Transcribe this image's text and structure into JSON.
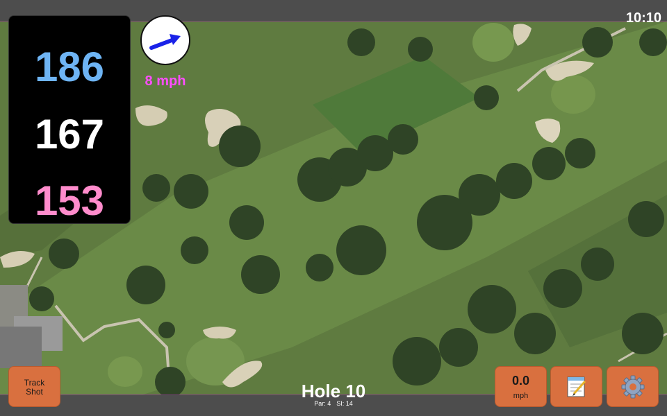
{
  "status_bar": {
    "time": "10:10"
  },
  "distances": {
    "back": "186",
    "middle": "167",
    "front": "153"
  },
  "wind": {
    "speed": "8 mph",
    "direction_icon": "arrow-right-up-icon"
  },
  "hole": {
    "title": "Hole 10",
    "par": "Par: 4",
    "stroke_index": "SI: 14"
  },
  "buttons": {
    "track_shot": "Track\nShot",
    "speed_value": "0.0",
    "speed_unit": "mph",
    "notes_icon": "notepad-icon",
    "settings_icon": "gear-icon"
  },
  "colors": {
    "back_distance": "#6eb4f4",
    "middle_distance": "#ffffff",
    "front_distance": "#ff8ccc",
    "wind_text": "#ff4dff",
    "button": "#d9703f"
  }
}
